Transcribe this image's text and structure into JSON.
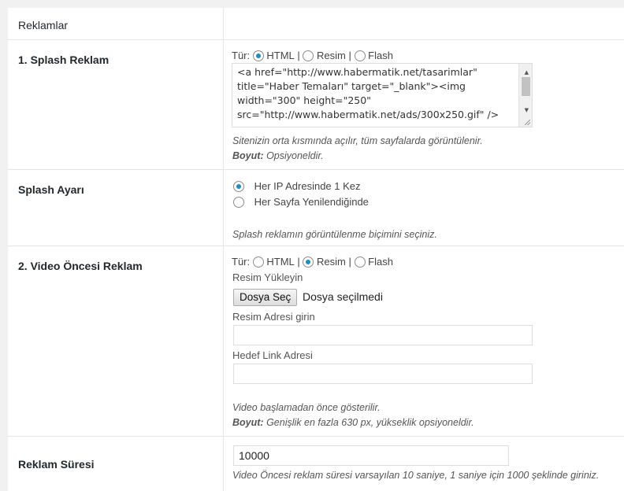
{
  "header": {
    "title": "Reklamlar"
  },
  "splash": {
    "label": "1. Splash Reklam",
    "type_label": "Tür:",
    "options": [
      "HTML",
      "Resim",
      "Flash"
    ],
    "separator": "|",
    "selected": "HTML",
    "code_lines": [
      "<a href=\"http://www.habermatik.net/tasarimlar\"",
      "title=\"Haber Temaları\" target=\"_blank\"><img",
      "width=\"300\" height=\"250\"",
      "src=\"http://www.habermatik.net/ads/300x250.gif\" />"
    ],
    "hint": "Sitenizin orta kısmında açılır, tüm sayfalarda görüntülenir.",
    "size_label": "Boyut:",
    "size_value": "Opsiyoneldir."
  },
  "splash_settings": {
    "label": "Splash Ayarı",
    "options": [
      "Her IP Adresinde 1 Kez",
      "Her Sayfa Yenilendiğinde"
    ],
    "selected_index": 0,
    "hint": "Splash reklamın görüntülenme biçimini seçiniz."
  },
  "video_ad": {
    "label": "2. Video Öncesi Reklam",
    "type_label": "Tür:",
    "options": [
      "HTML",
      "Resim",
      "Flash"
    ],
    "separator": "|",
    "selected": "Resim",
    "upload_label": "Resim Yükleyin",
    "file_button": "Dosya Seç",
    "file_status": "Dosya seçilmedi",
    "image_url_label": "Resim Adresi girin",
    "image_url_value": "",
    "link_label": "Hedef Link Adresi",
    "link_value": "",
    "hint": "Video başlamadan önce gösterilir.",
    "size_label": "Boyut:",
    "size_value": "Genişlik en fazla 630 px, yükseklik opsiyoneldir."
  },
  "duration": {
    "label": "Reklam Süresi",
    "value": "10000",
    "hint": "Video Öncesi reklam süresi varsayılan 10 saniye, 1 saniye için 1000 şeklinde giriniz."
  },
  "colors": {
    "accent": "#1e8cbe",
    "border": "#e5e5e5",
    "background": "#f1f1f1"
  }
}
